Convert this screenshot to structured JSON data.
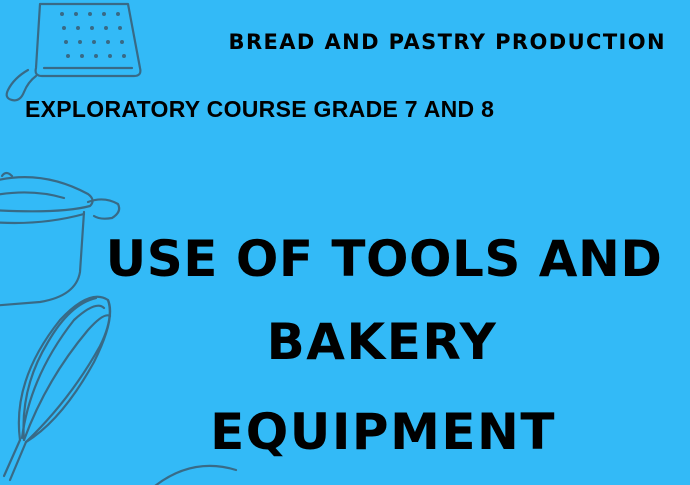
{
  "header": {
    "line1": "BREAD AND PASTRY PRODUCTION",
    "line2": "EXPLORATORY COURSE GRADE 7 AND 8"
  },
  "title": {
    "line1": "USE OF TOOLS AND",
    "line2": "BAKERY",
    "line3": "EQUIPMENT"
  },
  "colors": {
    "background": "#33baf7",
    "text": "#000000",
    "outline_art": "#3a5d73"
  },
  "decorations": [
    "box-grater-icon",
    "cooking-pot-icon",
    "whisk-icon",
    "bowl-icon"
  ]
}
